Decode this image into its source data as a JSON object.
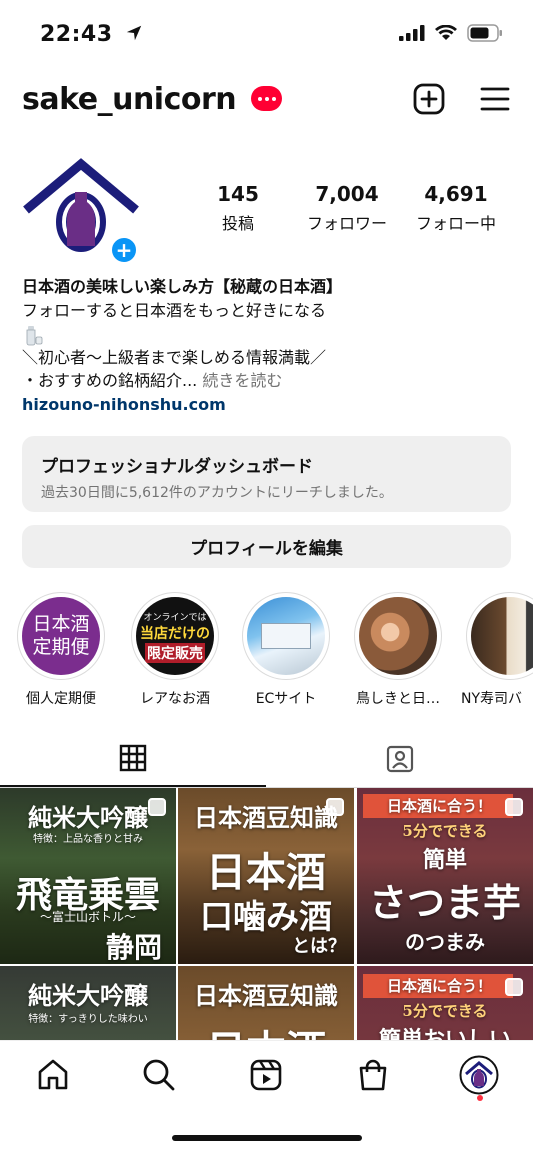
{
  "status_bar": {
    "time": "22:43"
  },
  "header": {
    "username": "sake_unicorn"
  },
  "stats": [
    {
      "num": "145",
      "label": "投稿"
    },
    {
      "num": "7,004",
      "label": "フォロワー"
    },
    {
      "num": "4,691",
      "label": "フォロー中"
    }
  ],
  "bio": {
    "name": "日本酒の美味しい楽しみ方【秘蔵の日本酒】",
    "line1": "フォローすると日本酒をもっと好きになる",
    "line2": "＼初心者〜上級者まで楽しめる情報満載／",
    "line3": "・おすすめの銘柄紹介...",
    "more": "続きを読む",
    "link": "hizouno-nihonshu.com"
  },
  "dashboard": {
    "title": "プロフェッショナルダッシュボード",
    "subtitle": "過去30日間に5,612件のアカウントにリーチしました。"
  },
  "edit_profile": "プロフィールを編集",
  "highlights": [
    {
      "label": "個人定期便",
      "cover": "日本酒\n定期便"
    },
    {
      "label": "レアなお酒",
      "cover_top": "オンラインでは",
      "cover_mid": "当店だけの",
      "cover_bot": "限定販売"
    },
    {
      "label": "ECサイト"
    },
    {
      "label": "鳥しきと日…"
    },
    {
      "label": "NY寿司バ"
    }
  ],
  "posts": [
    {
      "title": "純米大吟醸",
      "sub": "特徴：上品な香りと甘み",
      "main": "飛竜乗雲",
      "note": "〜富士山ボトル〜",
      "place": "静岡"
    },
    {
      "title": "日本酒豆知識",
      "main": "日本酒",
      "main2": "口噛み酒",
      "note": "とは？"
    },
    {
      "title": "日本酒に合う！",
      "sub": "5分でできる",
      "main": "簡単",
      "main2": "さつま芋",
      "note": "のつまみ"
    },
    {
      "title": "純米大吟醸",
      "sub": "特徴：すっきりした味わい"
    },
    {
      "title": "日本酒豆知識",
      "main": "日本酒"
    },
    {
      "title": "日本酒に合う！",
      "sub": "5分でできる",
      "main": "簡単おいしい"
    }
  ],
  "colors": {
    "accent_blue": "#0a95f6",
    "badge_red": "#ff0033",
    "link": "#00376b",
    "muted": "#737373"
  }
}
